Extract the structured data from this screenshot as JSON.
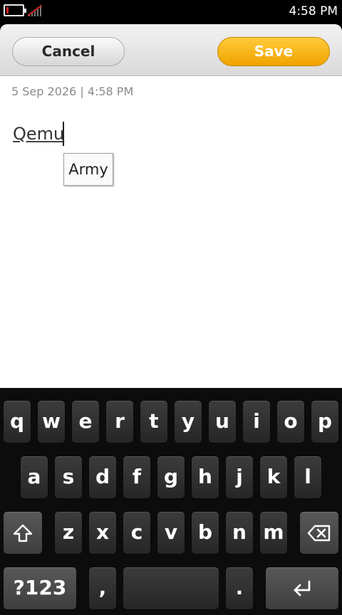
{
  "status_bar": {
    "time": "4:58 PM",
    "battery_fraction": 0.1
  },
  "toolbar": {
    "cancel_label": "Cancel",
    "save_label": "Save"
  },
  "note": {
    "timestamp": "5 Sep 2026 | 4:58 PM",
    "text": "Qemu",
    "suggestion": "Army"
  },
  "keyboard": {
    "row1": [
      "q",
      "w",
      "e",
      "r",
      "t",
      "y",
      "u",
      "i",
      "o",
      "p"
    ],
    "row2": [
      "a",
      "s",
      "d",
      "f",
      "g",
      "h",
      "j",
      "k",
      "l"
    ],
    "row3": [
      "z",
      "x",
      "c",
      "v",
      "b",
      "n",
      "m"
    ],
    "symbols_label": "?123",
    "comma": ",",
    "period": ".",
    "shift_icon": "shift-icon",
    "backspace_icon": "backspace-icon",
    "enter_icon": "enter-icon"
  },
  "colors": {
    "save_button": "#f5b417",
    "keyboard_bg": "#0c0c0c",
    "battery_low": "#d32020"
  }
}
